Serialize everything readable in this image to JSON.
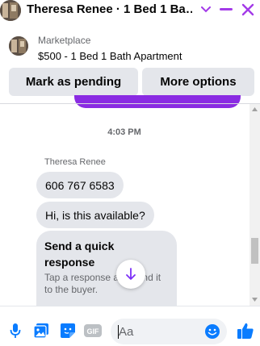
{
  "header": {
    "title": "Theresa Renee · 1 Bed 1 Ba…",
    "accent_color": "#a33ae8",
    "avatar_icon": "profile-photo"
  },
  "listing": {
    "subtitle": "Marketplace",
    "title": "$500 - 1 Bed 1 Bath Apartment"
  },
  "actions": {
    "mark_pending_label": "Mark as pending",
    "more_options_label": "More options"
  },
  "chat": {
    "timestamp": "4:03 PM",
    "sender_name": "Theresa Renee",
    "messages": [
      {
        "text": "606 767 6583"
      },
      {
        "text": "Hi, is this available?"
      }
    ],
    "quick_response": {
      "title": "Send a quick response",
      "description": "Tap a response and send it to the buyer."
    },
    "outgoing_bubble_color": "#8a2be2"
  },
  "composer": {
    "placeholder": "Aa",
    "icon_color": "#0a7cff",
    "icons": [
      "microphone-icon",
      "photo-icon",
      "sticker-icon",
      "gif-icon",
      "emoji-icon",
      "like-icon"
    ],
    "gif_label": "GIF"
  }
}
